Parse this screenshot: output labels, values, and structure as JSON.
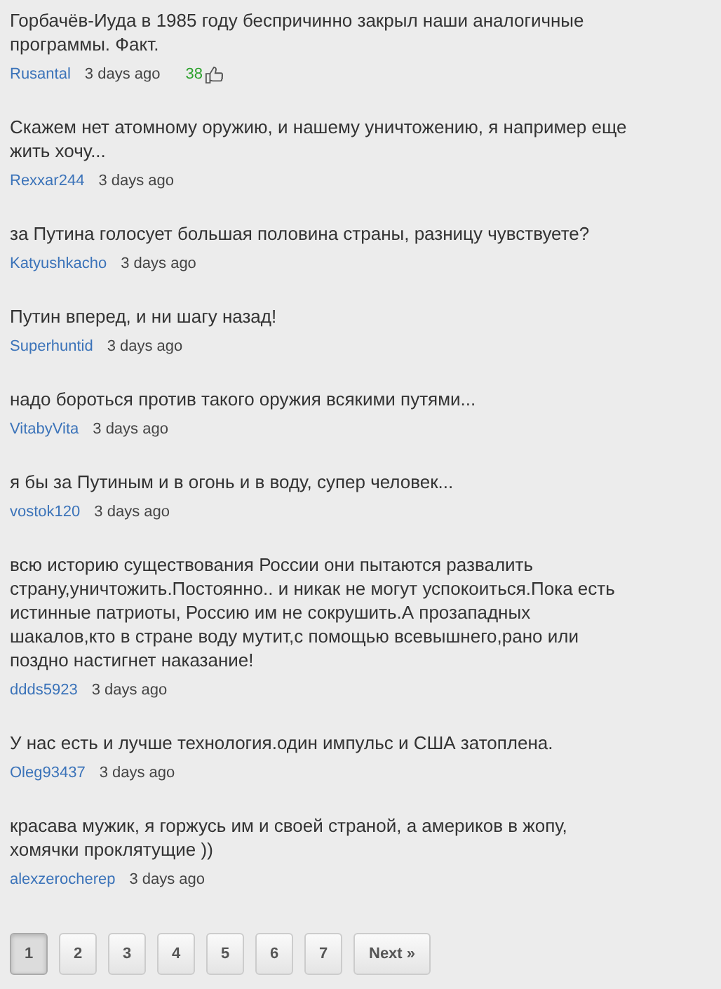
{
  "comments": [
    {
      "text": "Горбачёв-Иуда в 1985 году беспричинно закрыл наши аналогичные программы. Факт.",
      "author": "Rusantal",
      "time": "3 days ago",
      "likes": "38"
    },
    {
      "text": "Скажем нет атомному оружию, и нашему уничтожению, я например еще жить хочу...",
      "author": "Rexxar244",
      "time": "3 days ago"
    },
    {
      "text": "за Путина голосует большая половина страны, разницу чувствуете?",
      "author": "Katyushkacho",
      "time": "3 days ago"
    },
    {
      "text": "Путин вперед, и ни шагу назад!",
      "author": "Superhuntid",
      "time": "3 days ago"
    },
    {
      "text": "надо бороться против такого оружия всякими путями...",
      "author": "VitabyVita",
      "time": "3 days ago"
    },
    {
      "text": "я бы за Путиным и в огонь и в воду, супер человек...",
      "author": "vostok120",
      "time": "3 days ago"
    },
    {
      "text": "всю историю существования России они пытаются развалить страну,уничтожить.Постоянно.. и никак не могут успокоиться.Пока есть истинные патриоты, Россию им не сокрушить.А прозападных шакалов,кто в стране воду мутит,с помощью всевышнего,рано или поздно настигнет наказание!",
      "author": "ddds5923",
      "time": "3 days ago"
    },
    {
      "text": "У нас есть и лучше технология.один импульс и США затоплена.",
      "author": "Oleg93437",
      "time": "3 days ago"
    },
    {
      "text": "красава мужик, я горжусь им и своей страной, а америков в жопу, хомячки проклятущие ))",
      "author": "alexzerocherep",
      "time": "3 days ago"
    }
  ],
  "pagination": [
    {
      "label": "1",
      "selected": true
    },
    {
      "label": "2",
      "selected": false
    },
    {
      "label": "3",
      "selected": false
    },
    {
      "label": "4",
      "selected": false
    },
    {
      "label": "5",
      "selected": false
    },
    {
      "label": "6",
      "selected": false
    },
    {
      "label": "7",
      "selected": false
    },
    {
      "label": "Next »",
      "selected": false
    }
  ]
}
